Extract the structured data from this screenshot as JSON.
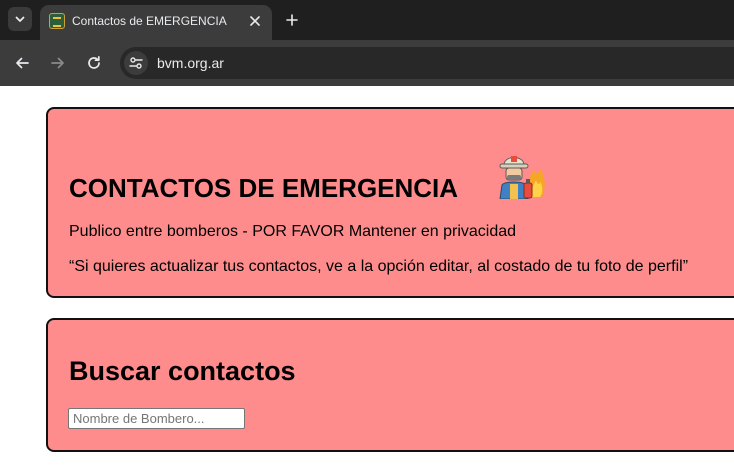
{
  "browser": {
    "tab_title": "Contactos de EMERGENCIA",
    "url": "bvm.org.ar",
    "icons": {
      "tab_search": "chevron-down-icon",
      "favicon": "site-favicon-icon",
      "close": "close-icon",
      "new_tab": "plus-icon",
      "back": "arrow-left-icon",
      "forward": "arrow-right-icon",
      "reload": "reload-icon",
      "site_info": "tune-icon"
    }
  },
  "emergency_card": {
    "title": "CONTACTOS DE EMERGENCIA",
    "title_icon": "firefighter-icon",
    "notice": "Publico entre bomberos - POR FAVOR Mantener en privacidad",
    "quote": "“Si quieres actualizar tus contactos, ve a la opción editar, al costado de tu foto de perfil”"
  },
  "search_card": {
    "title": "Buscar contactos",
    "input_placeholder": "Nombre de Bombero...",
    "input_value": ""
  },
  "colors": {
    "card_background": "#ff8c8c",
    "card_border": "#111111",
    "browser_frame": "#1f1f1f",
    "browser_toolbar": "#3c3c3c"
  }
}
